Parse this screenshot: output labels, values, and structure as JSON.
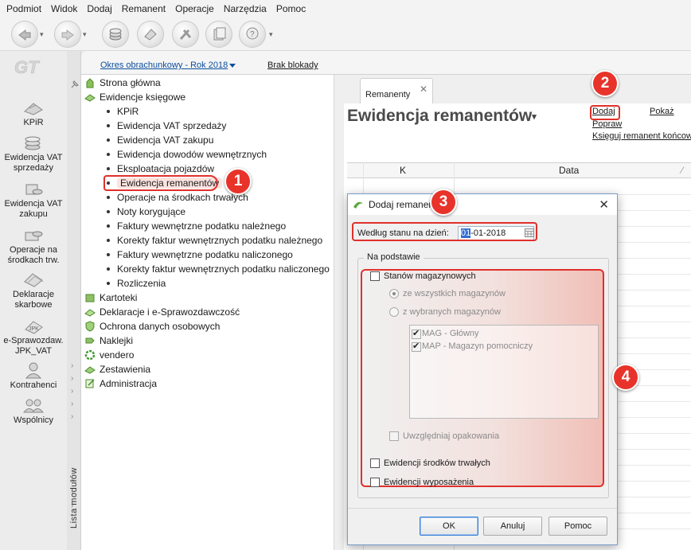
{
  "menubar": {
    "items": [
      "Podmiot",
      "Widok",
      "Dodaj",
      "Remanent",
      "Operacje",
      "Narzędzia",
      "Pomoc"
    ]
  },
  "toolbar": {
    "icons": [
      "back-icon",
      "forward-icon",
      "coins-icon",
      "eraser-icon",
      "tools-icon",
      "pages-icon",
      "help-icon"
    ]
  },
  "leftbar": {
    "items": [
      {
        "label": "KPiR",
        "icon": "ledger-icon"
      },
      {
        "label": "Ewidencja VAT sprzedaży",
        "icon": "coins-icon"
      },
      {
        "label": "Ewidencja VAT zakupu",
        "icon": "coins-icon"
      },
      {
        "label": "Operacje na środkach trw.",
        "icon": "coins-icon"
      },
      {
        "label": "Deklaracje skarbowe",
        "icon": "documents-icon"
      },
      {
        "label": "e-Sprawozdaw. JPK_VAT",
        "icon": "jpk-icon"
      },
      {
        "label": "Kontrahenci",
        "icon": "person-icon"
      },
      {
        "label": "Wspólnicy",
        "icon": "people-icon"
      }
    ],
    "vertical_label": "Lista modułów"
  },
  "topstrip": {
    "period": "Okres obrachunkowy - Rok 2018",
    "lock_status": "Brak blokady"
  },
  "tree": {
    "items": [
      {
        "label": "Strona główna",
        "level": 0,
        "icon": "home-icon"
      },
      {
        "label": "Ewidencje księgowe",
        "level": 0,
        "icon": "books-icon"
      },
      {
        "label": "KPiR",
        "level": 1
      },
      {
        "label": "Ewidencja VAT sprzedaży",
        "level": 1
      },
      {
        "label": "Ewidencja VAT zakupu",
        "level": 1
      },
      {
        "label": "Ewidencja dowodów wewnętrznych",
        "level": 1
      },
      {
        "label": "Eksploatacja pojazdów",
        "level": 1
      },
      {
        "label": "Ewidencja remanentów",
        "level": 1,
        "selected": true
      },
      {
        "label": "Operacje na środkach trwałych",
        "level": 1
      },
      {
        "label": "Noty korygujące",
        "level": 1
      },
      {
        "label": "Faktury wewnętrzne podatku należnego",
        "level": 1
      },
      {
        "label": "Korekty faktur wewnętrznych podatku należnego",
        "level": 1
      },
      {
        "label": "Faktury wewnętrzne podatku naliczonego",
        "level": 1
      },
      {
        "label": "Korekty faktur wewnętrznych podatku naliczonego",
        "level": 1
      },
      {
        "label": "Rozliczenia",
        "level": 1
      },
      {
        "label": "Kartoteki",
        "level": 0,
        "icon": "folder-icon"
      },
      {
        "label": "Deklaracje i e-Sprawozdawczość",
        "level": 0,
        "icon": "declaration-icon"
      },
      {
        "label": "Ochrona danych osobowych",
        "level": 0,
        "icon": "shield-icon"
      },
      {
        "label": "Naklejki",
        "level": 0,
        "icon": "label-icon"
      },
      {
        "label": "vendero",
        "level": 0,
        "icon": "gear-icon"
      },
      {
        "label": "Zestawienia",
        "level": 0,
        "icon": "chart-icon"
      },
      {
        "label": "Administracja",
        "level": 0,
        "icon": "admin-icon"
      }
    ]
  },
  "right": {
    "tab_label": "Remanenty",
    "title": "Ewidencja remanentów",
    "actions": {
      "add": "Dodaj",
      "show": "Pokaż",
      "edit": "Popraw",
      "book": "Księguj remanent końcowy"
    },
    "grid_headers": {
      "col_k": "K",
      "col_data": "Data"
    }
  },
  "dialog": {
    "title": "Dodaj remanent",
    "date_label": "Według stanu na dzień:",
    "date_selected": "01",
    "date_rest": "-01-2018",
    "group_title": "Na podstawie",
    "stanow_mag": "Stanów magazynowych",
    "all_mag": "ze wszystkich magazynów",
    "selected_mag": "z wybranych magazynów",
    "warehouses": [
      "MAG - Główny",
      "MAP - Magazyn pomocniczy"
    ],
    "packaging": "Uwzględniaj opakowania",
    "fixed_assets": "Ewidencji środków trwałych",
    "equipment": "Ewidencji wyposażenia",
    "ok": "OK",
    "cancel": "Anuluj",
    "help": "Pomoc"
  },
  "annotations": {
    "badges": [
      "1",
      "2",
      "3",
      "4"
    ],
    "highlight_color": "#e0302b"
  }
}
